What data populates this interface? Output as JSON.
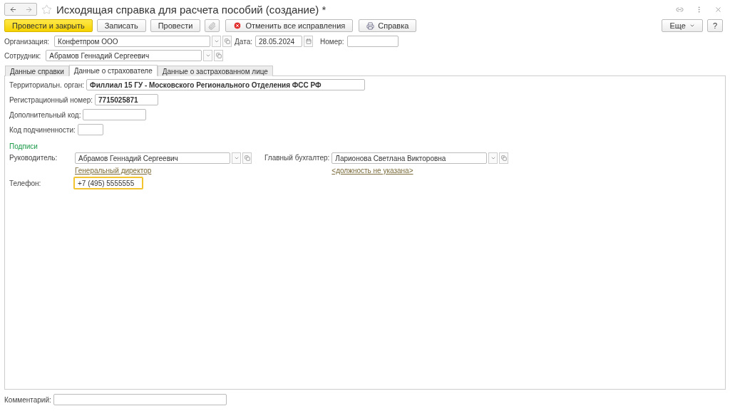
{
  "window": {
    "title": "Исходящая справка для расчета пособий (создание) *",
    "favorite": false
  },
  "toolbar": [
    {
      "label": "Провести и закрыть",
      "kind": "primary"
    },
    {
      "label": "Записать",
      "kind": "plain"
    },
    {
      "label": "Провести",
      "kind": "plain"
    },
    {
      "kind": "attach"
    },
    {
      "label": "Отменить все исправления",
      "kind": "cancel"
    },
    {
      "label": "Справка",
      "kind": "print"
    }
  ],
  "more_button": "Еще",
  "help_button": "?",
  "organization": {
    "label": "Организация:",
    "value": "Конфетпром ООО"
  },
  "date": {
    "label": "Дата:",
    "value": "28.05.2024"
  },
  "number": {
    "label": "Номер:"
  },
  "employee": {
    "label": "Сотрудник:",
    "value": "Абрамов Геннадий Сергеевич"
  },
  "tabs": [
    {
      "label": "Данные справки",
      "selected": false
    },
    {
      "label": "Данные о страхователе",
      "selected": true
    },
    {
      "label": "Данные о застрахованном лице",
      "selected": false
    }
  ],
  "fields": [
    {
      "label": "Территориальн. орган:",
      "value": "Филлиал 15 ГУ - Московского Регионального Отделения ФСС РФ",
      "kind": "wide"
    },
    {
      "label": "Регистрационный номер:",
      "value": "7715025871",
      "kind": "medium"
    },
    {
      "label": "Дополнительный код:",
      "kind": "medium"
    },
    {
      "label": "Код подчиненности:",
      "kind": "small"
    }
  ],
  "signatures": {
    "heading": "Подписи",
    "manager": {
      "label": "Руководитель:",
      "value": "Абрамов Геннадий Сергеевич",
      "position": "Генеральный директор"
    },
    "accountant": {
      "label": "Главный бухгалтер:",
      "value": "Ларионова Светлана Викторовна",
      "position": "<должность не указана>"
    }
  },
  "phone": {
    "label": "Телефон:",
    "value": "+7 (495) 5555555",
    "focused": true
  },
  "comment": {
    "label": "Комментарий:"
  }
}
